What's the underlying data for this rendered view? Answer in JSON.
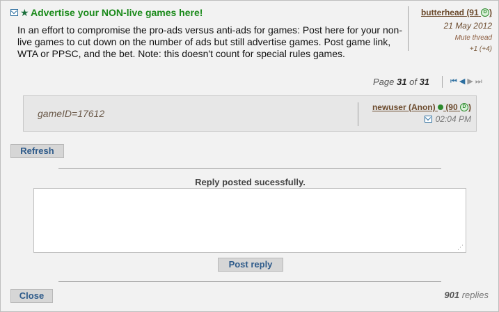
{
  "thread": {
    "title": "Advertise your NON-live games here!",
    "body": "In an effort to compromise the pro-ads versus anti-ads for games: Post here for your non-live games to cut down on the number of ads but still advertise games. Post game link, WTA or PPSC, and the bet. Note: this doesn't count for special rules games.",
    "author": "butterhead",
    "author_rating_open": "(91",
    "author_rating_close": ")",
    "date": "21 May 2012",
    "mute_label": "Mute thread",
    "score": "+1 (+4)"
  },
  "pager": {
    "prefix": "Page",
    "current": "31",
    "of": "of",
    "total": "31",
    "nav": [
      "first-page-icon",
      "prev-page-icon",
      "next-page-icon",
      "last-page-icon"
    ]
  },
  "post": {
    "text": "gameID=17612",
    "author": "newuser (Anon)",
    "rating_open": "(90",
    "rating_close": ")",
    "time": "02:04 PM"
  },
  "buttons": {
    "refresh": "Refresh",
    "post_reply": "Post reply",
    "close": "Close"
  },
  "reply": {
    "status": "Reply posted sucessfully.",
    "value": ""
  },
  "footer": {
    "count": "901",
    "label": "replies"
  },
  "colors": {
    "title_green": "#1a8a1a",
    "author_brown": "#6b4a2c",
    "link_blue": "#2d5a8a",
    "panel_bg": "#f2f2f2"
  }
}
